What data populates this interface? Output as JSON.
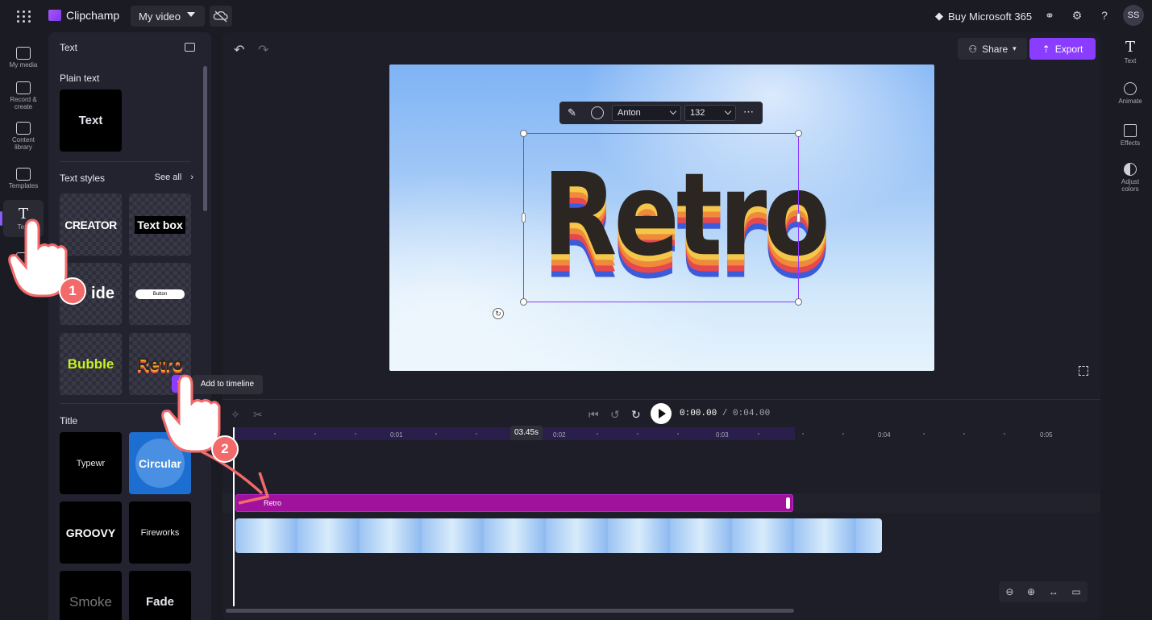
{
  "app": {
    "name": "Clipchamp",
    "project_name": "My video",
    "buy_label": "Buy Microsoft 365",
    "avatar_initials": "SS"
  },
  "left_rail": [
    {
      "label": "My media",
      "icon": "folder-icon"
    },
    {
      "label": "Record & create",
      "icon": "camera-icon"
    },
    {
      "label": "Content library",
      "icon": "library-icon"
    },
    {
      "label": "Templates",
      "icon": "templates-icon"
    },
    {
      "label": "Text",
      "icon": "text-icon",
      "active": true
    }
  ],
  "panel": {
    "title": "Text",
    "plain_text_title": "Plain text",
    "plain_text_tile": "Text",
    "text_styles_title": "Text styles",
    "see_all": "See all",
    "styles": [
      "CREATOR",
      "Text box",
      "ide",
      "Button",
      "Bubble",
      "Retro"
    ],
    "title_section": "Title",
    "titles": [
      "Typewr",
      "Circular",
      "GROOVY",
      "Fireworks",
      "Smoke",
      "Fade"
    ],
    "add_to_timeline_tooltip": "Add to timeline"
  },
  "toolbar": {
    "share": "Share",
    "export": "Export"
  },
  "editor": {
    "text_content": "Retro",
    "font": "Anton",
    "font_size": "132"
  },
  "playback": {
    "current": "0:00.00",
    "separator": " / ",
    "duration": "0:04.00"
  },
  "timeline": {
    "cursor_time": "03.45s",
    "ticks": [
      "0:01",
      "0:02",
      "0:03",
      "0:04",
      "0:05"
    ],
    "text_clip_label": "Retro"
  },
  "right_rail": [
    {
      "label": "Text",
      "icon": "text-icon"
    },
    {
      "label": "Animate",
      "icon": "animate-icon"
    },
    {
      "label": "Effects",
      "icon": "effects-icon"
    },
    {
      "label": "Adjust colors",
      "icon": "adjust-colors-icon"
    }
  ],
  "annotations": {
    "step1": "1",
    "step2": "2"
  },
  "colors": {
    "accent": "#8b3dff",
    "text_clip": "#a0129c",
    "step_badge": "#f26a6a"
  }
}
